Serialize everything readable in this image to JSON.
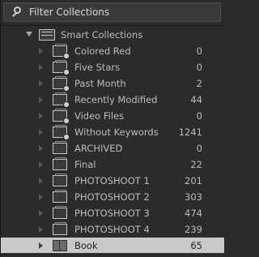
{
  "filter": {
    "placeholder": "Filter Collections"
  },
  "tree": {
    "parent": {
      "label": "Smart Collections"
    },
    "items": [
      {
        "label": "Colored Red",
        "count": "0",
        "icon": "smart-collection-icon"
      },
      {
        "label": "Five Stars",
        "count": "0",
        "icon": "smart-collection-icon"
      },
      {
        "label": "Past Month",
        "count": "2",
        "icon": "smart-collection-icon"
      },
      {
        "label": "Recently Modified",
        "count": "44",
        "icon": "smart-collection-icon"
      },
      {
        "label": "Video Files",
        "count": "0",
        "icon": "smart-collection-icon"
      },
      {
        "label": "Without Keywords",
        "count": "1241",
        "icon": "smart-collection-icon"
      },
      {
        "label": "ARCHIVED",
        "count": "0",
        "icon": "collection-icon"
      },
      {
        "label": "Final",
        "count": "22",
        "icon": "collection-icon"
      },
      {
        "label": "PHOTOSHOOT 1",
        "count": "201",
        "icon": "collection-icon"
      },
      {
        "label": "PHOTOSHOOT 2",
        "count": "303",
        "icon": "collection-icon"
      },
      {
        "label": "PHOTOSHOOT 3",
        "count": "474",
        "icon": "collection-icon"
      },
      {
        "label": "PHOTOSHOOT 4",
        "count": "239",
        "icon": "collection-icon"
      },
      {
        "label": "Book",
        "count": "65",
        "icon": "book-icon",
        "selected": true
      }
    ]
  },
  "colors": {
    "panel_bg": "#2b2b2b",
    "text": "#bdbdbd",
    "selected_bg": "#c9c9c9",
    "selected_text": "#1e1e1e"
  }
}
